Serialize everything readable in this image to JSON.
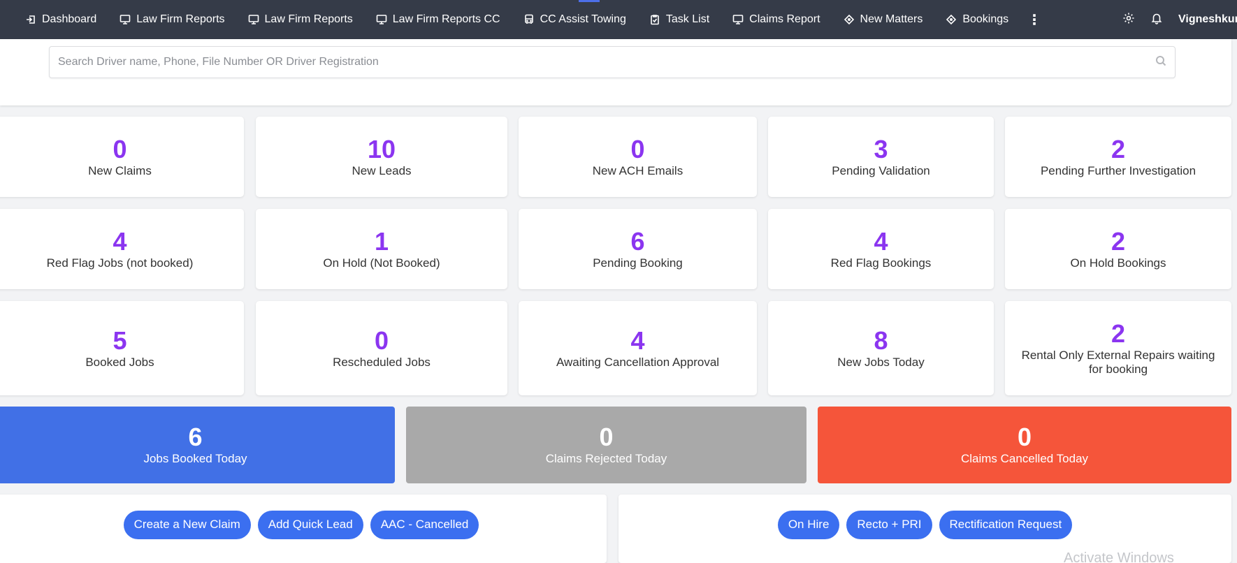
{
  "nav": {
    "items": [
      {
        "label": "Dashboard",
        "icon": "login-arrow-icon"
      },
      {
        "label": "Law Firm Reports",
        "icon": "monitor-icon"
      },
      {
        "label": "Law Firm Reports",
        "icon": "monitor-icon"
      },
      {
        "label": "Law Firm Reports CC",
        "icon": "monitor-icon"
      },
      {
        "label": "CC Assist Towing",
        "icon": "truck-icon"
      },
      {
        "label": "Task List",
        "icon": "clipboard-icon"
      },
      {
        "label": "Claims Report",
        "icon": "monitor-icon"
      },
      {
        "label": "New Matters",
        "icon": "diamond-icon"
      },
      {
        "label": "Bookings",
        "icon": "diamond-icon"
      }
    ],
    "more": "⋮",
    "user": "Vigneshkur"
  },
  "search": {
    "placeholder": "Search Driver name, Phone, File Number OR Driver Registration",
    "value": ""
  },
  "stats": [
    {
      "value": "0",
      "label": "New Claims"
    },
    {
      "value": "10",
      "label": "New Leads"
    },
    {
      "value": "0",
      "label": "New ACH Emails"
    },
    {
      "value": "3",
      "label": "Pending Validation"
    },
    {
      "value": "2",
      "label": "Pending Further Investigation"
    },
    {
      "value": "4",
      "label": "Red Flag Jobs (not booked)"
    },
    {
      "value": "1",
      "label": "On Hold (Not Booked)"
    },
    {
      "value": "6",
      "label": "Pending Booking"
    },
    {
      "value": "4",
      "label": "Red Flag Bookings"
    },
    {
      "value": "2",
      "label": "On Hold Bookings"
    },
    {
      "value": "5",
      "label": "Booked Jobs"
    },
    {
      "value": "0",
      "label": "Rescheduled Jobs"
    },
    {
      "value": "4",
      "label": "Awaiting Cancellation Approval"
    },
    {
      "value": "8",
      "label": "New Jobs Today"
    },
    {
      "value": "2",
      "label": "Rental Only External Repairs waiting for booking"
    }
  ],
  "summary": [
    {
      "value": "6",
      "label": "Jobs Booked Today",
      "color": "#4170e6"
    },
    {
      "value": "0",
      "label": "Claims Rejected Today",
      "color": "#a9a9a9"
    },
    {
      "value": "0",
      "label": "Claims Cancelled Today",
      "color": "#f5553a"
    }
  ],
  "actions_left": [
    "Create a New Claim",
    "Add Quick Lead",
    "AAC - Cancelled"
  ],
  "actions_right": [
    "On Hire",
    "Recto + PRI",
    "Rectification Request"
  ],
  "watermark": "Activate Windows",
  "colors": {
    "accent_number": "#8b35f0",
    "nav_bg": "#353b48",
    "pill": "#3b6ff0"
  }
}
